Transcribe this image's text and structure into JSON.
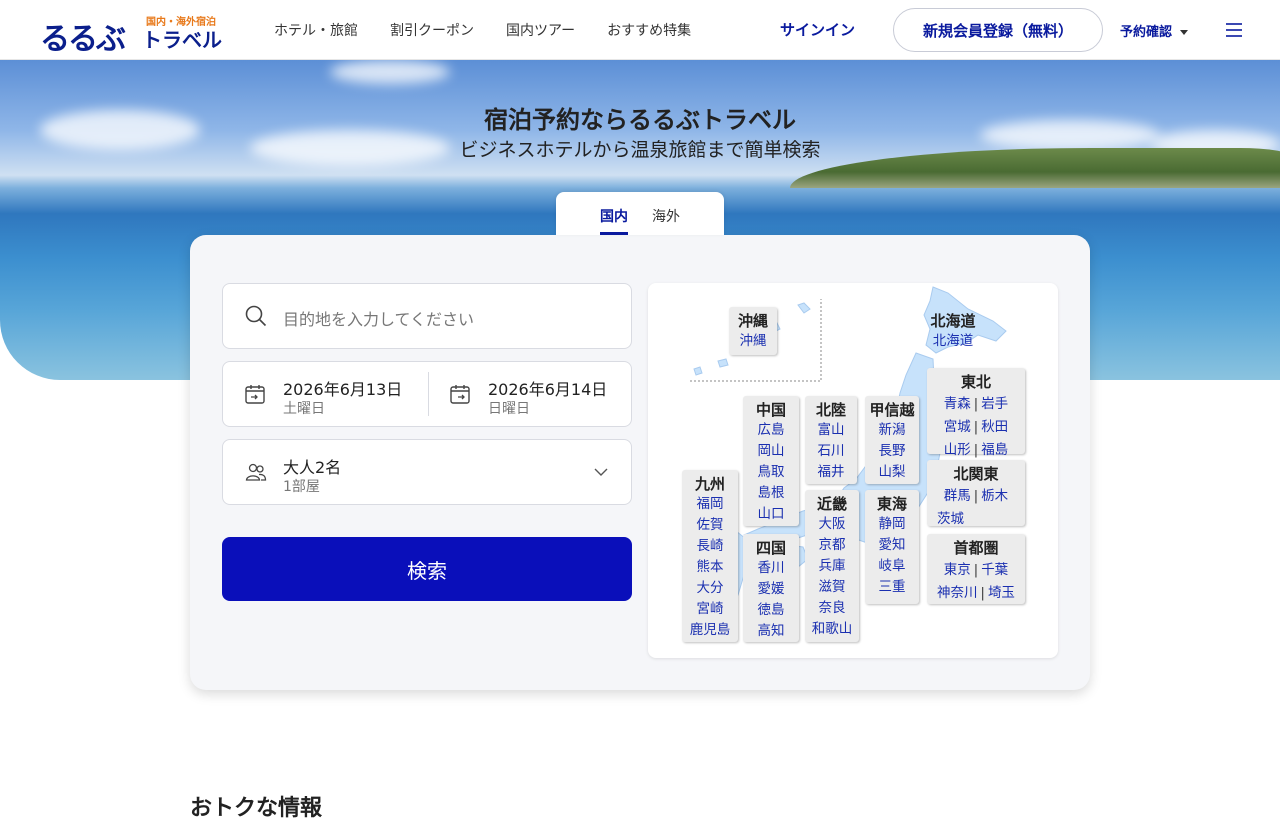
{
  "header": {
    "logo_main": "るるぶ",
    "logo_sub": "国内・海外宿泊",
    "logo_travel": "トラベル",
    "nav": [
      "ホテル・旅館",
      "割引クーポン",
      "国内ツアー",
      "おすすめ特集"
    ],
    "signin": "サインイン",
    "register": "新規会員登録（無料）",
    "booking": "予約確認"
  },
  "hero": {
    "title": "宿泊予約ならるるぶトラベル",
    "subtitle": "ビジネスホテルから温泉旅館まで簡単検索"
  },
  "tabs": [
    "国内",
    "海外"
  ],
  "search": {
    "destination_placeholder": "目的地を入力してください",
    "checkin_date": "2026年6月13日",
    "checkin_day": "土曜日",
    "checkout_date": "2026年6月14日",
    "checkout_day": "日曜日",
    "guests": "大人2名",
    "rooms": "1部屋",
    "button": "検索"
  },
  "map": {
    "okinawa": {
      "name": "沖縄",
      "prefs": [
        "沖縄"
      ]
    },
    "hokkaido": {
      "name": "北海道",
      "prefs": [
        "北海道"
      ]
    },
    "tohoku": {
      "name": "東北",
      "prefs": [
        "青森",
        "岩手",
        "宮城",
        "秋田",
        "山形",
        "福島"
      ]
    },
    "kitakanto": {
      "name": "北関東",
      "prefs": [
        "群馬",
        "栃木",
        "茨城"
      ]
    },
    "shutoken": {
      "name": "首都圏",
      "prefs": [
        "東京",
        "千葉",
        "神奈川",
        "埼玉"
      ]
    },
    "koshinetsu": {
      "name": "甲信越",
      "prefs": [
        "新潟",
        "長野",
        "山梨"
      ]
    },
    "tokai": {
      "name": "東海",
      "prefs": [
        "静岡",
        "愛知",
        "岐阜",
        "三重"
      ]
    },
    "hokuriku": {
      "name": "北陸",
      "prefs": [
        "富山",
        "石川",
        "福井"
      ]
    },
    "kinki": {
      "name": "近畿",
      "prefs": [
        "大阪",
        "京都",
        "兵庫",
        "滋賀",
        "奈良",
        "和歌山"
      ]
    },
    "chugoku": {
      "name": "中国",
      "prefs": [
        "広島",
        "岡山",
        "鳥取",
        "島根",
        "山口"
      ]
    },
    "shikoku": {
      "name": "四国",
      "prefs": [
        "香川",
        "愛媛",
        "徳島",
        "高知"
      ]
    },
    "kyushu": {
      "name": "九州",
      "prefs": [
        "福岡",
        "佐賀",
        "長崎",
        "熊本",
        "大分",
        "宮崎",
        "鹿児島"
      ]
    }
  },
  "section_title": "おトクな情報",
  "colors": {
    "brand": "#0a1a9e",
    "button": "#0a0fba",
    "logo_accent": "#e8791a"
  }
}
